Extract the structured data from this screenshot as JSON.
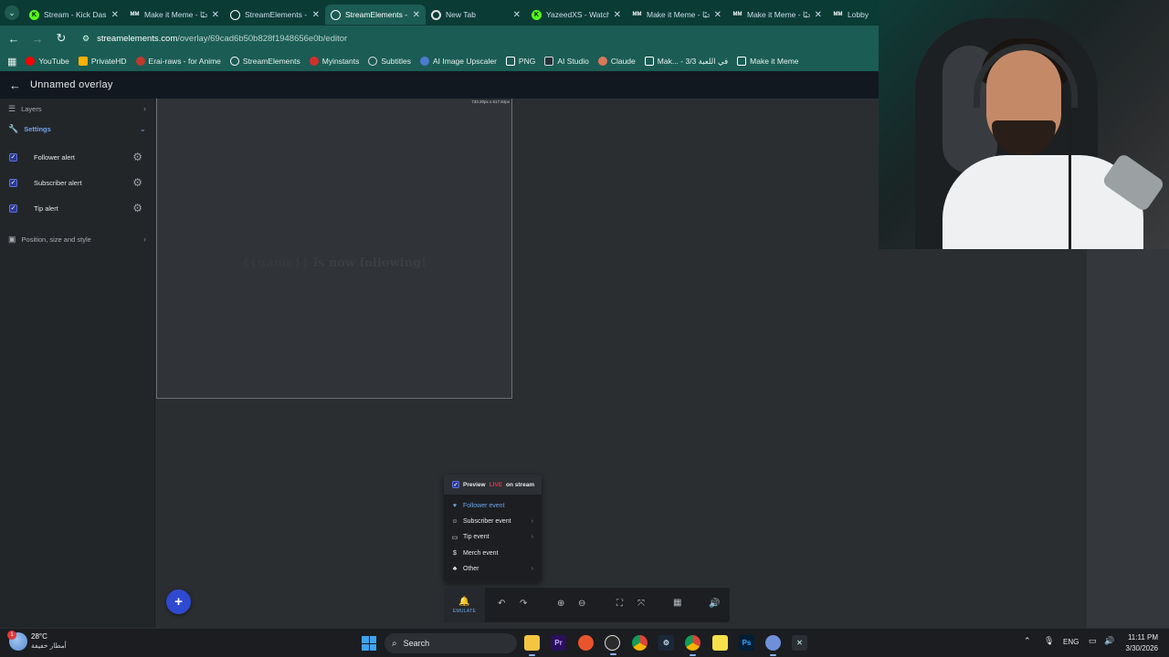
{
  "browser": {
    "tabs": [
      {
        "title": "Stream - Kick Dash",
        "favicon": "K",
        "color": "#53fc18",
        "active": false
      },
      {
        "title": "Make it Meme - مرحبًا",
        "favicon": "MM",
        "color": "#ffffff",
        "active": false
      },
      {
        "title": "StreamElements -",
        "favicon": "SE",
        "color": "#ffffff",
        "active": false
      },
      {
        "title": "StreamElements -",
        "favicon": "SE",
        "color": "#ffffff",
        "active": true
      },
      {
        "title": "New Tab",
        "favicon": "G",
        "color": "#ffffff",
        "active": false
      },
      {
        "title": "YazeedXS - Watch",
        "favicon": "K",
        "color": "#53fc18",
        "active": false
      },
      {
        "title": "Make it Meme - مرحبًا",
        "favicon": "MM",
        "color": "#ffffff",
        "active": false
      },
      {
        "title": "Make it Meme - مرحبًا",
        "favicon": "MM",
        "color": "#ffffff",
        "active": false
      },
      {
        "title": "Lobby i",
        "favicon": "MM",
        "color": "#ffffff",
        "active": false
      }
    ],
    "url_host": "streamelements.com",
    "url_path": "/overlay/69cad6b50b828f1948656e0b/editor",
    "bookmarks": [
      {
        "label": "YouTube",
        "color": "#ff0000"
      },
      {
        "label": "PrivateHD",
        "color": "#ffb000"
      },
      {
        "label": "Erai-raws - for Anime",
        "color": "#c0392b"
      },
      {
        "label": "StreamElements",
        "color": "#ffffff"
      },
      {
        "label": "Myinstants",
        "color": "#d32f2f"
      },
      {
        "label": "Subtitles",
        "color": "#dddddd"
      },
      {
        "label": "AI Image Upscaler",
        "color": "#4a7bd0"
      },
      {
        "label": "PNG",
        "color": "#ffffff"
      },
      {
        "label": "AI Studio",
        "color": "#cfd8dc"
      },
      {
        "label": "Claude",
        "color": "#d97757"
      },
      {
        "label": "Mak... - 3/3 في اللعبة",
        "color": "#ffffff"
      },
      {
        "label": "Make it Meme",
        "color": "#ffffff"
      }
    ]
  },
  "app": {
    "title": "Unnamed overlay"
  },
  "sidebar": {
    "layers_label": "Layers",
    "settings_label": "Settings",
    "alerts": [
      {
        "label": "Follower alert",
        "checked": true
      },
      {
        "label": "Subscriber alert",
        "checked": true
      },
      {
        "label": "Tip alert",
        "checked": true
      }
    ],
    "position_label": "Position, size and style"
  },
  "widget": {
    "dimensions": "733.20px x 617.84px",
    "name_text": "{{name}}",
    "message_text": "is now following!"
  },
  "emulate_menu": {
    "preview_prefix": "Preview",
    "preview_live": "LIVE",
    "preview_suffix": "on stream",
    "items": [
      {
        "label": "Follower event",
        "icon": "heart-icon",
        "glyph": "♥",
        "has_sub": false,
        "active": true
      },
      {
        "label": "Subscriber event",
        "icon": "user-star-icon",
        "glyph": "👤",
        "has_sub": true,
        "active": false
      },
      {
        "label": "Tip event",
        "icon": "card-icon",
        "glyph": "▭",
        "has_sub": true,
        "active": false
      },
      {
        "label": "Merch event",
        "icon": "dollar-icon",
        "glyph": "$",
        "has_sub": false,
        "active": false
      },
      {
        "label": "Other",
        "icon": "shapes-icon",
        "glyph": "♣",
        "has_sub": true,
        "active": false
      }
    ]
  },
  "toolbar": {
    "emulate_label": "EMULATE"
  },
  "taskbar": {
    "weather_temp": "28°C",
    "weather_desc": "أمطار خفيفة",
    "weather_badge": "1",
    "search_placeholder": "Search",
    "language": "ENG",
    "time": "11:11 PM",
    "date": "3/30/2026"
  },
  "colors": {
    "accent": "#2f4ad0",
    "link_blue": "#6fa4ea",
    "live_red": "#e7344a",
    "browser_frame": "#1b5c54"
  }
}
